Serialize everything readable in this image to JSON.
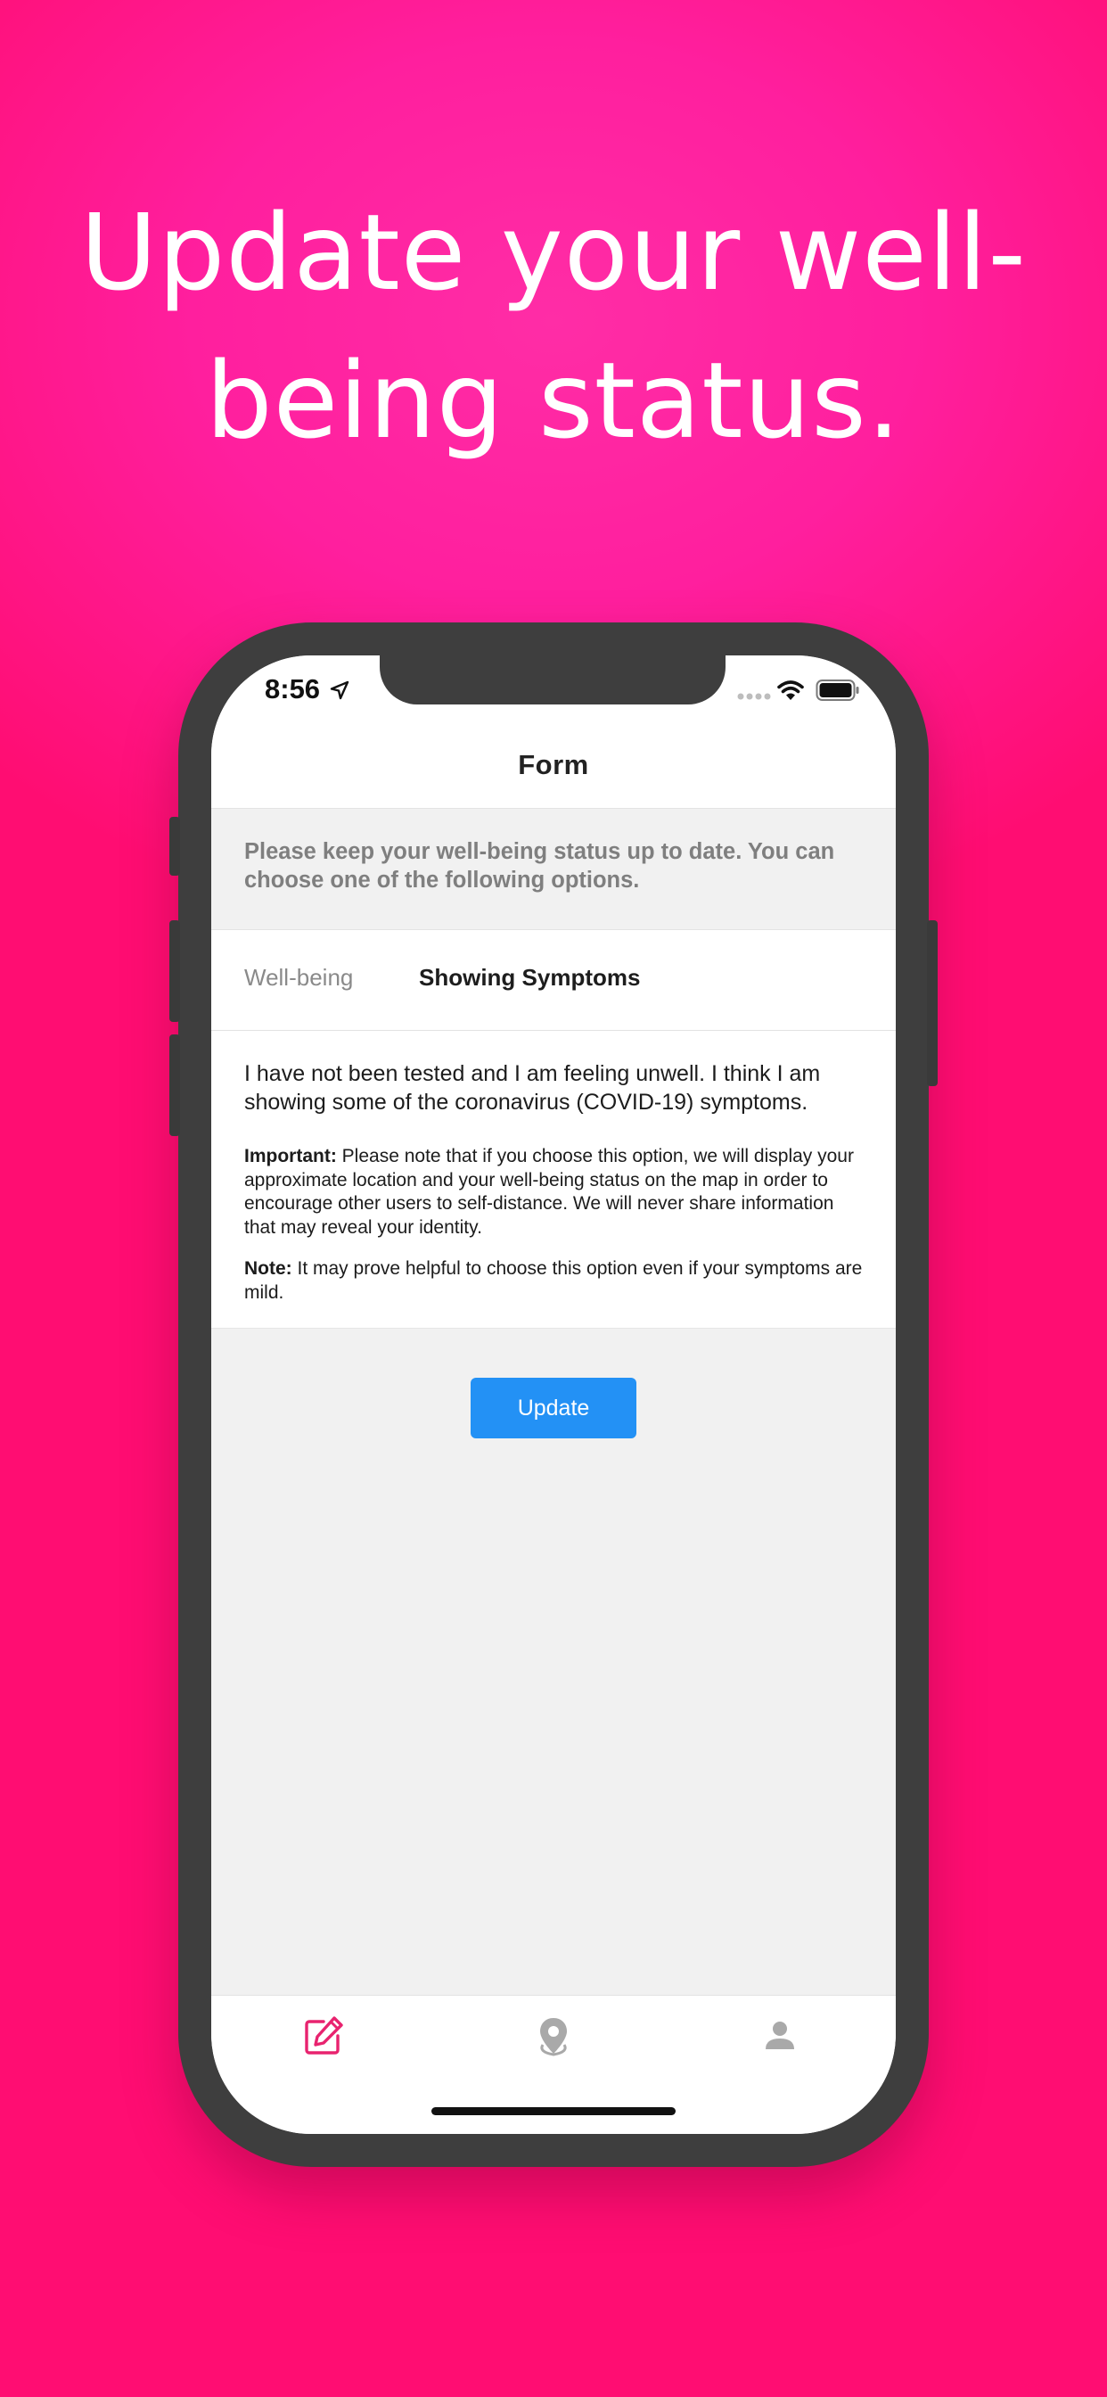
{
  "headline": {
    "line1": "Update your well-",
    "line2": "being status."
  },
  "status_bar": {
    "time": "8:56"
  },
  "nav": {
    "title": "Form"
  },
  "intro": {
    "text": "Please keep your well-being status up to date. You can choose one of the following options."
  },
  "segments": {
    "wellbeing": "Well-being",
    "symptoms": "Showing Symptoms",
    "selected": "Showing Symptoms"
  },
  "details": {
    "main": "I have not been tested and I am feeling unwell. I think I am showing some of the coronavirus (COVID-19) symptoms.",
    "important_label": "Important:",
    "important_text": " Please note that if you choose this option, we will display your approximate location and your well-being status on the map in order to encourage other users to self-distance. We will never share information that may reveal your identity.",
    "note_label": "Note:",
    "note_text": " It may prove helpful to choose this option even if your symptoms are mild."
  },
  "actions": {
    "update_label": "Update"
  },
  "tab_bar": {
    "items": [
      {
        "icon": "edit-form-icon",
        "active": true
      },
      {
        "icon": "map-pin-icon",
        "active": false
      },
      {
        "icon": "profile-icon",
        "active": false
      }
    ]
  },
  "colors": {
    "background_top": "#ff2da6",
    "background_bottom": "#ff0d72",
    "accent_active_tab": "#e8236f",
    "button": "#2391f5",
    "inactive_tab": "#a9a9a9"
  }
}
